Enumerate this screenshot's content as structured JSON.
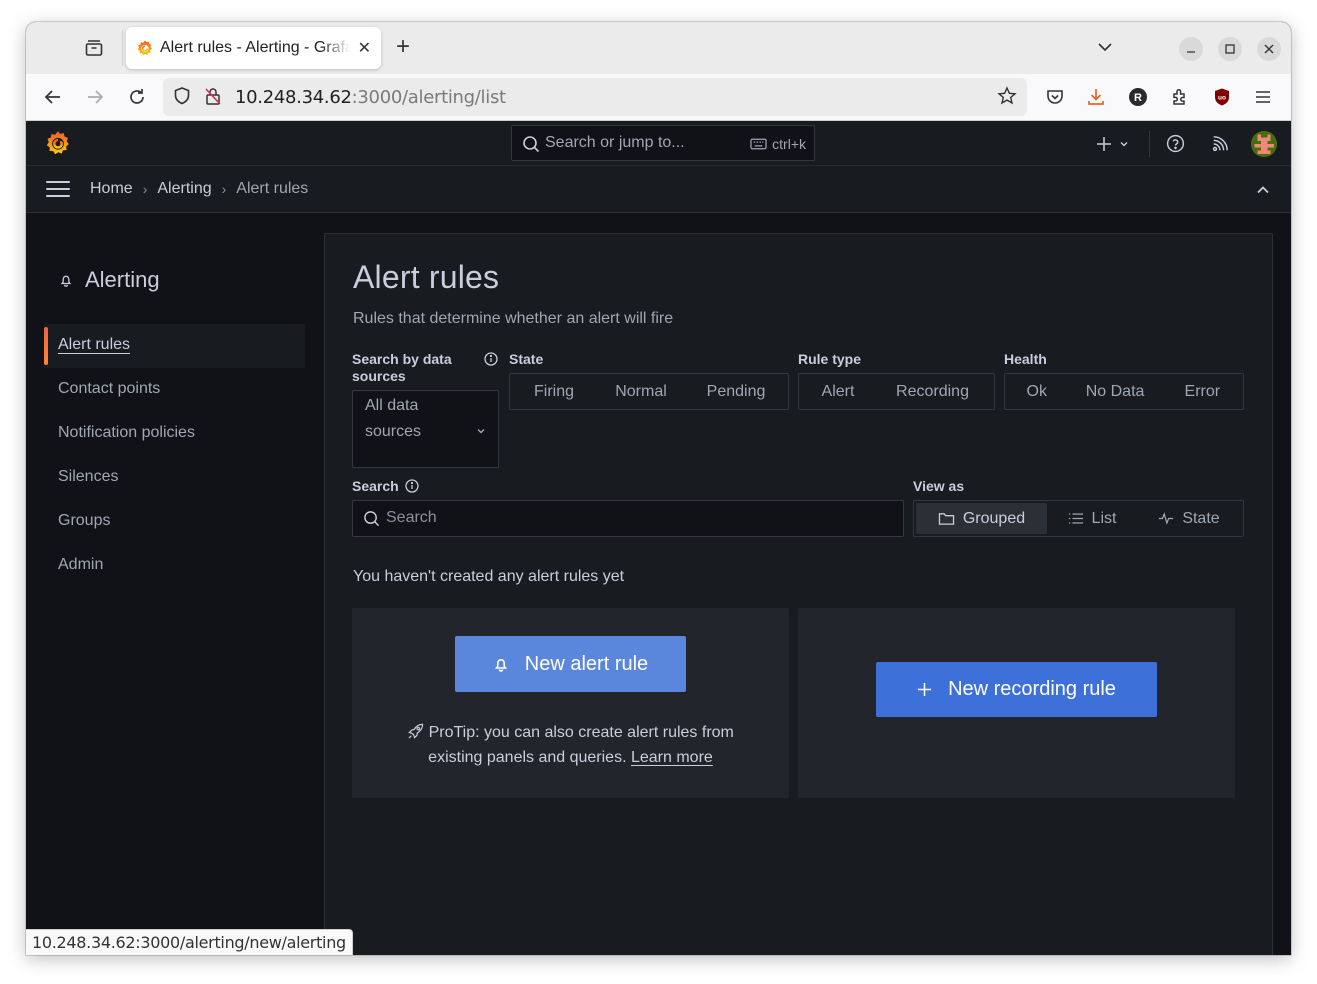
{
  "browser": {
    "tab": {
      "title": "Alert rules - Alerting - Grafana",
      "favicon": "grafana-logo-icon",
      "close_icon": "close-icon"
    },
    "new_tab_label": "+",
    "address": {
      "host": "10.248.34.62",
      "path": ":3000/alerting/list"
    },
    "toolbar_icons": [
      "star-icon",
      "pocket-icon",
      "download-icon",
      "r-extension-icon",
      "extensions-icon",
      "ublock-icon",
      "hamburger-menu-icon"
    ],
    "window_controls": [
      "minimize",
      "maximize",
      "close"
    ],
    "status_url": "10.248.34.62:3000/alerting/new/alerting"
  },
  "topbar": {
    "search_placeholder": "Search or jump to...",
    "search_shortcut": "ctrl+k",
    "icons": [
      "plus-icon",
      "help-icon",
      "news-rss-icon",
      "user-avatar"
    ]
  },
  "breadcrumb": {
    "items": [
      "Home",
      "Alerting",
      "Alert rules"
    ]
  },
  "sidebar": {
    "section_title": "Alerting",
    "section_icon": "bell-icon",
    "items": [
      {
        "label": "Alert rules",
        "active": true
      },
      {
        "label": "Contact points",
        "active": false
      },
      {
        "label": "Notification policies",
        "active": false
      },
      {
        "label": "Silences",
        "active": false
      },
      {
        "label": "Groups",
        "active": false
      },
      {
        "label": "Admin",
        "active": false
      }
    ]
  },
  "main": {
    "title": "Alert rules",
    "subtitle": "Rules that determine whether an alert will fire",
    "filters": {
      "datasource_label": "Search by data sources",
      "datasource_label_line1": "Search by data",
      "datasource_label_line2": "sources",
      "datasource_value_line1": "All data",
      "datasource_value_line2": "sources",
      "state_label": "State",
      "state_options": [
        "Firing",
        "Normal",
        "Pending"
      ],
      "rule_type_label": "Rule type",
      "rule_type_options": [
        "Alert",
        "Recording"
      ],
      "health_label": "Health",
      "health_options": [
        "Ok",
        "No Data",
        "Error"
      ],
      "search_label": "Search",
      "search_placeholder": "Search",
      "search_value": "",
      "view_as_label": "View as",
      "view_as_options": [
        {
          "label": "Grouped",
          "icon": "folder-icon",
          "selected": true
        },
        {
          "label": "List",
          "icon": "list-icon",
          "selected": false
        },
        {
          "label": "State",
          "icon": "heartbeat-icon",
          "selected": false
        }
      ]
    },
    "empty_state": {
      "message": "You haven't created any alert rules yet",
      "new_alert_button": "New alert rule",
      "protip_line1": "ProTip: you can also create alert rules from",
      "protip_line2": "existing panels and queries.",
      "learn_more": "Learn more",
      "new_recording_button": "New recording rule"
    }
  },
  "colors": {
    "primary_button": "#3d71d9",
    "primary_button_hover": "#5a87dc",
    "active_accent": "#f55f3e",
    "background": "#111217",
    "panel": "#181b1f",
    "card": "#22252b"
  }
}
